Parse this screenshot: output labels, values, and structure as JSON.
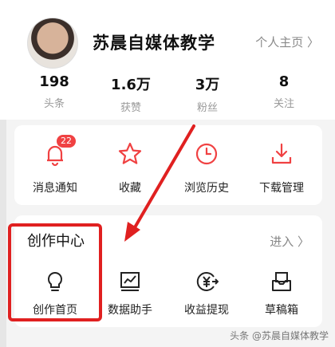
{
  "profile": {
    "name": "苏晨自媒体教学",
    "home_link": "个人主页 〉"
  },
  "stats": [
    {
      "num": "198",
      "label": "头条"
    },
    {
      "num": "1.6万",
      "label": "获赞"
    },
    {
      "num": "3万",
      "label": "粉丝"
    },
    {
      "num": "8",
      "label": "关注"
    }
  ],
  "quick": [
    {
      "label": "消息通知",
      "icon": "bell-icon",
      "badge": "22"
    },
    {
      "label": "收藏",
      "icon": "star-icon"
    },
    {
      "label": "浏览历史",
      "icon": "clock-icon"
    },
    {
      "label": "下载管理",
      "icon": "download-icon"
    }
  ],
  "creator": {
    "title": "创作中心",
    "enter": "进入 〉",
    "items": [
      {
        "label": "创作首页",
        "icon": "lightbulb-icon"
      },
      {
        "label": "数据助手",
        "icon": "chart-icon"
      },
      {
        "label": "收益提现",
        "icon": "yuan-coin-icon"
      },
      {
        "label": "草稿箱",
        "icon": "draft-box-icon"
      }
    ]
  },
  "watermark": "头条 @苏晨自媒体教学",
  "colors": {
    "accent": "#f04142",
    "highlight": "#e02020"
  }
}
